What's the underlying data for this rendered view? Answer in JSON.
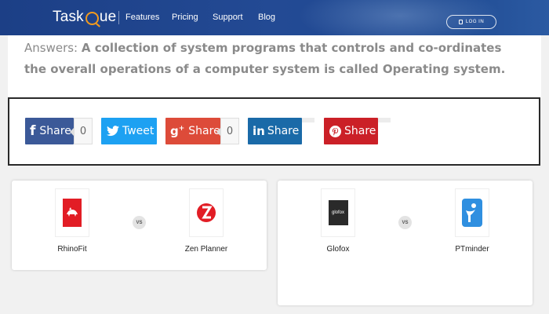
{
  "nav": {
    "logo_part1": "Task",
    "logo_part2": "ue",
    "links": [
      "Features",
      "Pricing",
      "Support",
      "Blog"
    ],
    "login_label": "LOG IN"
  },
  "answer": {
    "label": "Answers:",
    "text": "A collection of system programs that controls and co-ordinates the overall operations of a computer system is called Operating system."
  },
  "share": {
    "facebook": {
      "label": "Share",
      "count": "0",
      "color": "#3b5998",
      "icon": "facebook-icon"
    },
    "twitter": {
      "label": "Tweet",
      "color": "#1da1f2",
      "icon": "twitter-icon"
    },
    "googleplus": {
      "label": "Share",
      "count": "0",
      "color": "#dd4b39",
      "icon": "googleplus-icon"
    },
    "linkedin": {
      "label": "Share",
      "color": "#1a6aa8",
      "icon": "linkedin-icon"
    },
    "pinterest": {
      "label": "Share",
      "color": "#cb2027",
      "icon": "pinterest-icon"
    }
  },
  "comparisons": [
    {
      "left": "RhinoFit",
      "vs": "VS",
      "right": "Zen Planner"
    },
    {
      "left": "Glofox",
      "vs": "VS",
      "right": "PTminder"
    }
  ],
  "logos": {
    "glofox_text": "glofox"
  }
}
